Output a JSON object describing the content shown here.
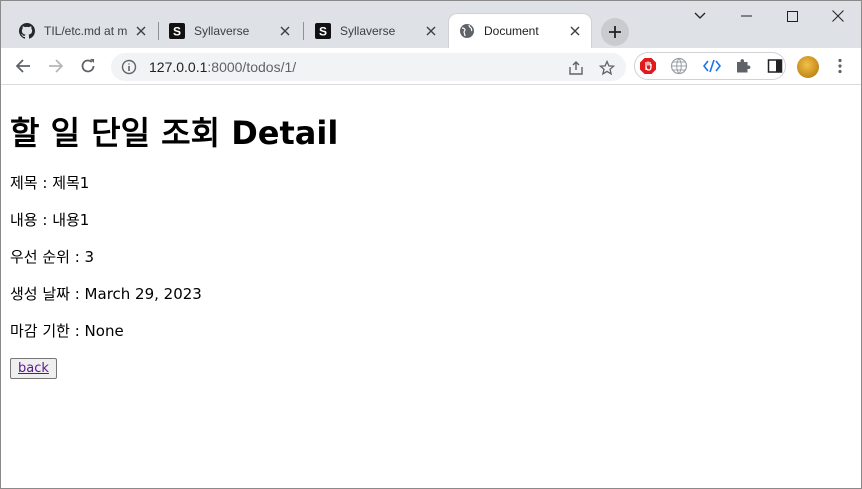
{
  "browser": {
    "tabs": [
      {
        "title": "TIL/etc.md at m",
        "favicon": "github-icon",
        "active": false
      },
      {
        "title": "Syllaverse",
        "favicon": "syllaverse-icon",
        "active": false
      },
      {
        "title": "Syllaverse",
        "favicon": "syllaverse-icon",
        "active": false
      },
      {
        "title": "Document",
        "favicon": "globe-icon",
        "active": true
      }
    ],
    "url_host": "127.0.0.1",
    "url_rest": ":8000/todos/1/"
  },
  "page": {
    "heading": "할 일 단일 조회 Detail",
    "rows": [
      "제목 : 제목1",
      "내용 : 내용1",
      "우선 순위 : 3",
      "생성 날짜 : March 29, 2023",
      "마감 기한 : None"
    ],
    "back_label": "back"
  },
  "colors": {
    "tabstrip_bg": "#dee1e6",
    "omnibox_bg": "#f1f3f4",
    "link_visited": "#551a8b"
  }
}
